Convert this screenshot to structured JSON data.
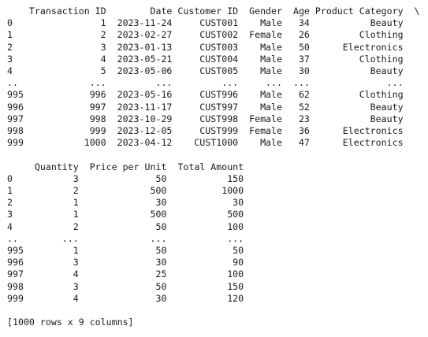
{
  "output": {
    "table1_header": "    Transaction ID        Date Customer ID  Gender  Age Product Category  \\",
    "table1_rows": [
      "0                1  2023-11-24     CUST001    Male   34           Beauty",
      "1                2  2023-02-27     CUST002  Female   26         Clothing",
      "2                3  2023-01-13     CUST003    Male   50      Electronics",
      "3                4  2023-05-21     CUST004    Male   37         Clothing",
      "4                5  2023-05-06     CUST005    Male   30           Beauty",
      "..             ...         ...         ...     ...  ...              ...",
      "995            996  2023-05-16     CUST996    Male   62         Clothing",
      "996            997  2023-11-17     CUST997    Male   52           Beauty",
      "997            998  2023-10-29     CUST998  Female   23           Beauty",
      "998            999  2023-12-05     CUST999  Female   36      Electronics",
      "999           1000  2023-04-12    CUST1000    Male   47      Electronics"
    ],
    "table2_header": "     Quantity  Price per Unit  Total Amount",
    "table2_rows": [
      "0           3              50           150",
      "1           2             500          1000",
      "2           1              30            30",
      "3           1             500           500",
      "4           2              50           100",
      "..        ...             ...           ...",
      "995         1              50            50",
      "996         3              30            90",
      "997         4              25           100",
      "998         3              50           150",
      "999         4              30           120"
    ],
    "summary": "[1000 rows x 9 columns]"
  }
}
